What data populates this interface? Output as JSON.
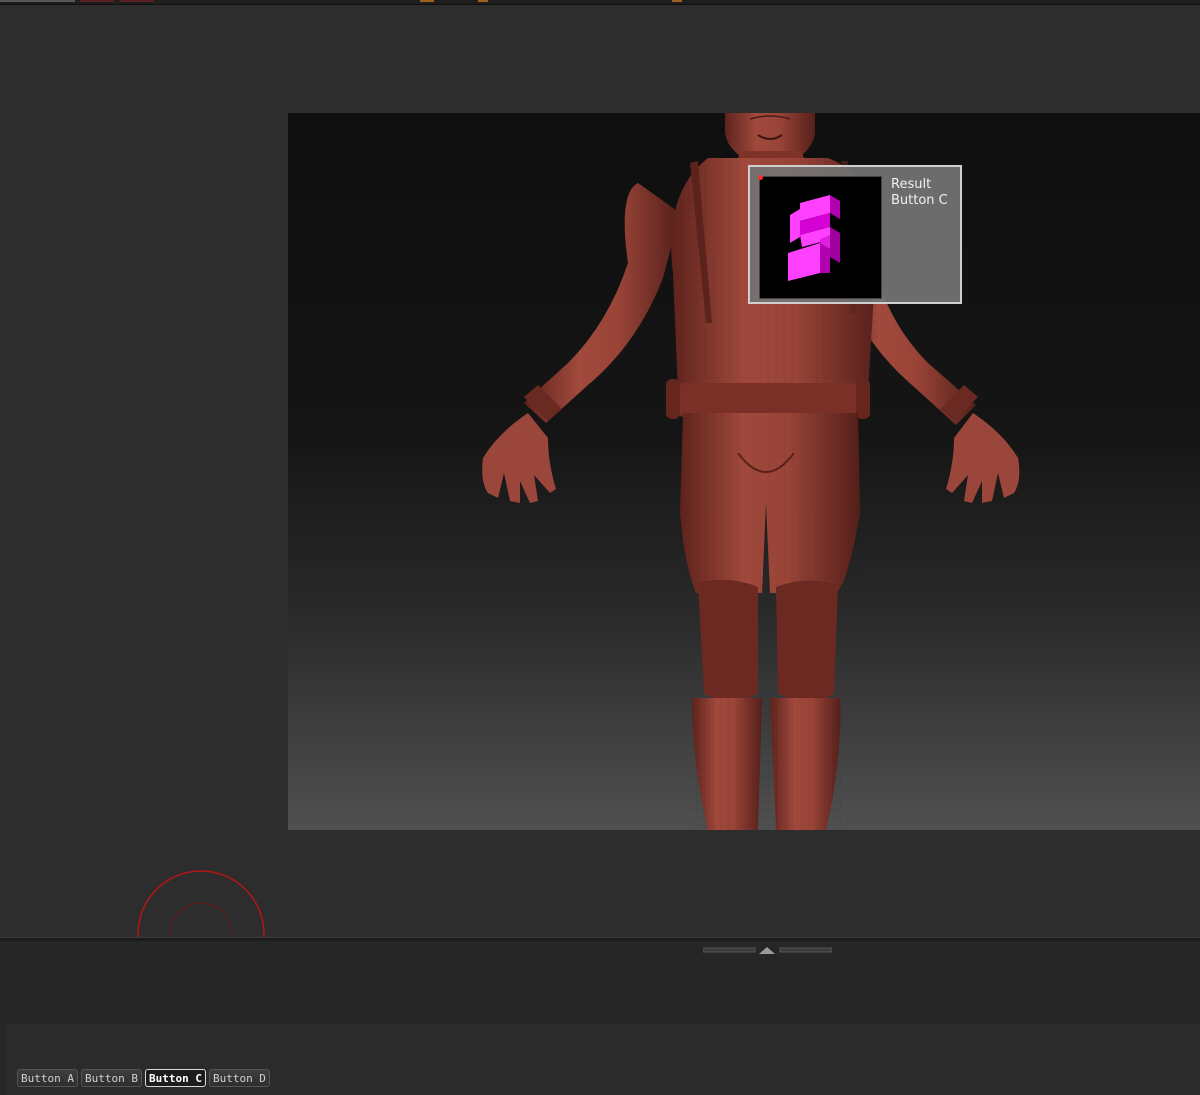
{
  "tooltip": {
    "title": "Result",
    "subtitle": "Button C",
    "thumbnail_icon": "zscript-s-icon"
  },
  "toolbar": {
    "buttons": [
      {
        "label": "Button A",
        "active": false
      },
      {
        "label": "Button B",
        "active": false
      },
      {
        "label": "Button C",
        "active": true
      },
      {
        "label": "Button D",
        "active": false
      }
    ]
  },
  "colors": {
    "model": "#8a3a30",
    "accent_magenta": "#d400d4",
    "gizmo_red": "#b01818"
  }
}
